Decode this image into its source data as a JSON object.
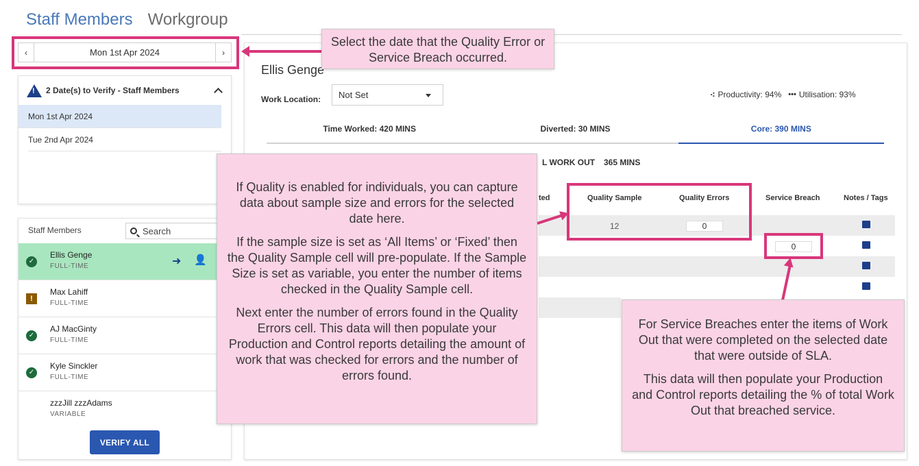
{
  "header": {
    "tab_active": "Staff Members",
    "tab_inactive": "Workgroup"
  },
  "date_picker": {
    "prev_glyph": "‹",
    "date": "Mon 1st Apr 2024",
    "next_glyph": "›"
  },
  "verify": {
    "title": "2 Date(s) to Verify - Staff Members",
    "items": [
      "Mon 1st Apr 2024",
      "Tue 2nd Apr 2024"
    ]
  },
  "staff": {
    "header": "Staff Members",
    "search_placeholder": "Search",
    "members": [
      {
        "name": "Ellis Genge",
        "type": "FULL-TIME",
        "status": "verified"
      },
      {
        "name": "Max Lahiff",
        "type": "FULL-TIME",
        "status": "warning"
      },
      {
        "name": "AJ MacGinty",
        "type": "FULL-TIME",
        "status": "verified"
      },
      {
        "name": "Kyle Sinckler",
        "type": "FULL-TIME",
        "status": "verified"
      },
      {
        "name": "zzzJill zzzAdams",
        "type": "VARIABLE",
        "status": "none"
      }
    ],
    "verify_all": "VERIFY ALL"
  },
  "main": {
    "employee_name": "Ellis Genge",
    "work_location_label": "Work Location:",
    "work_location_value": "Not Set",
    "productivity": "Productivity: 94%",
    "utilisation": "Utilisation: 93%",
    "tabs": [
      "Time Worked: 420 MINS",
      "Diverted: 30 MINS",
      "Core: 390 MINS"
    ],
    "workout_label": "L WORK OUT",
    "workout_value": "365 MINS",
    "columns": {
      "partial": "ted",
      "quality_sample": "Quality Sample",
      "quality_errors": "Quality Errors",
      "service_breach": "Service Breach",
      "notes_tags": "Notes / Tags"
    },
    "row1_quality_sample": "12",
    "row1_quality_errors": "0",
    "row2_service_breach": "0"
  },
  "callouts": {
    "date_select": "Select the date that the Quality Error or Service Breach occurred.",
    "quality_p1": "If Quality is enabled for individuals, you can capture data about sample size and errors for the selected date here.",
    "quality_p2": "If the sample size is set as ‘All Items’ or ‘Fixed’ then the Quality Sample cell will pre-populate. If the Sample Size is set as variable, you enter the number of items checked in the Quality Sample cell.",
    "quality_p3": "Next enter the number of errors found in the Quality Errors cell. This data will then populate your Production and Control reports detailing the amount of work that was checked for errors and the number of errors found.",
    "breach_p1": "For Service Breaches enter the items of Work Out that were completed on the selected date that were outside of SLA.",
    "breach_p2": "This data will then populate your Production and Control reports detailing the % of total Work Out that breached service."
  },
  "colors": {
    "accent_blue": "#2a57b0",
    "highlight_pink": "#d8377b",
    "callout_bg": "#fbd3e6",
    "selected_row_green": "#a8e6bf"
  }
}
